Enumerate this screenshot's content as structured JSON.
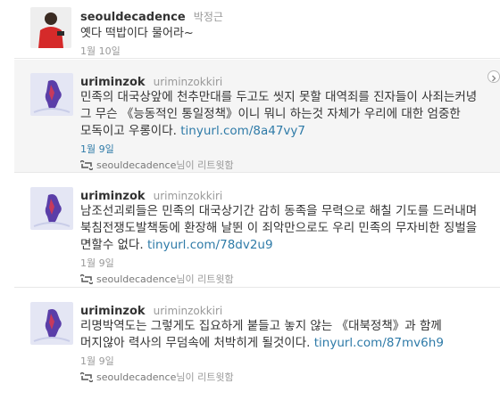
{
  "tweets": [
    {
      "username": "seouldecadence",
      "fullname": "박정근",
      "text": "옛다 떡밥이다 물어라~",
      "time": "1월 10일"
    },
    {
      "username": "uriminzok",
      "fullname": "uriminzokkiri",
      "text": "민족의 대국상앞에 천추만대를 두고도 씻지 못할 대역죄를 진자들이 사죄는커녕 그 무슨 《능동적인 통일정책》이니 뭐니 하는것 자체가 우리에 대한 엄중한 모독이고 우롱이다.",
      "link": "tinyurl.com/8a47vy7",
      "time": "1월 9일",
      "retweeted_by": "seouldecadence",
      "retweet_suffix": "님이 리트윗함"
    },
    {
      "username": "uriminzok",
      "fullname": "uriminzokkiri",
      "text": "남조선괴뢰들은 민족의 대국상기간 감히 동족을 무력으로 해칠 기도를 드러내며 북침전쟁도발책동에 환장해 날뛴 이 죄악만으로도 우리 민족의 무자비한 징벌을 면할수 없다.",
      "link": "tinyurl.com/78dv2u9",
      "time": "1월 9일",
      "retweeted_by": "seouldecadence",
      "retweet_suffix": "님이 리트윗함"
    },
    {
      "username": "uriminzok",
      "fullname": "uriminzokkiri",
      "text": "리명박역도는 그렇게도 집요하게 붙들고 놓지 않는 《대북정책》과 함께 머지않아 력사의 무덤속에 처박히게 될것이다.",
      "link": "tinyurl.com/87mv6h9",
      "time": "1월 9일",
      "retweeted_by": "seouldecadence",
      "retweet_suffix": "님이 리트윗함"
    }
  ],
  "icons": {
    "expand": "chevron-right-icon",
    "retweet": "retweet-icon"
  },
  "colors": {
    "link": "#2f7ba8",
    "hover_bg": "#f5f5f5",
    "muted": "#999999"
  }
}
